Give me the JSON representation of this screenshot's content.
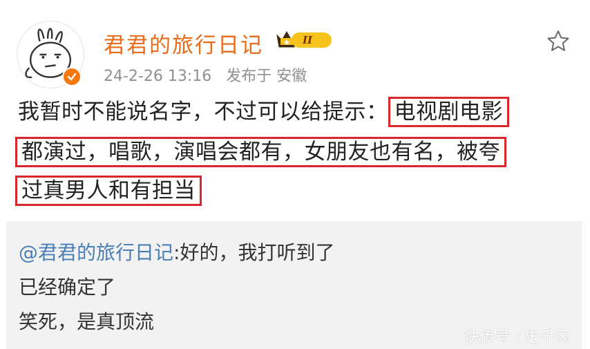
{
  "post": {
    "username": "君君的旅行日记",
    "vip_level": "II",
    "date": "24-2-26 13:16",
    "location": "发布于 安徽",
    "lines": {
      "l1_plain": "我暂时不能说名字，不过可以给提示：",
      "l1_hl": "电视剧电影",
      "l2_hl": "都演过，唱歌，演唱会都有，女朋友也有名，被夸",
      "l3_hl": "过真男人和有担当"
    }
  },
  "comment": {
    "mention": "@君君的旅行日记",
    "reply": ":好的，我打听到了",
    "line2": "已经确定了",
    "line3": "笑死，是真顶流"
  },
  "watermark": "快传号 / 史千冈",
  "colors": {
    "username": "#e86c1a",
    "highlight_border": "#d9262b",
    "mention": "#4a7eb4",
    "meta": "#8f8f8f",
    "comment_bg": "#f2f2f2"
  },
  "icons": {
    "avatar": "cartoon-face-avatar",
    "verify": "verified-badge-icon",
    "vip": "crown-icon",
    "star": "star-outline-icon"
  }
}
